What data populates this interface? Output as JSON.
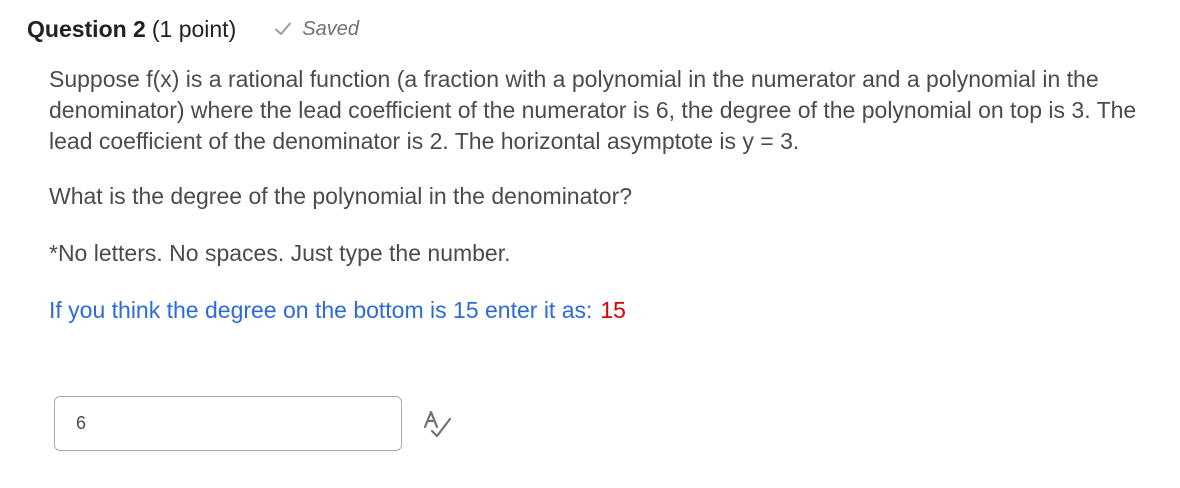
{
  "question": {
    "name": "Question 2",
    "points": "(1 point)",
    "status": "Saved",
    "status_icon": "check-icon"
  },
  "body": {
    "paragraph1": "Suppose f(x) is a rational function (a fraction with a polynomial in the numerator and a polynomial in the denominator) where the lead coefficient of the numerator is 6, the degree of the polynomial on top is 3.  The lead coefficient of the denominator is 2.  The horizontal asymptote is y = 3.",
    "paragraph2": "What is the degree of the polynomial in the denominator?",
    "paragraph3": "*No letters.  No spaces.  Just type the number.",
    "paragraph4": "If you think the degree on the bottom is 15 enter it as:",
    "example_value": "15"
  },
  "answer": {
    "value": "6"
  },
  "toolbar": {
    "spell_check_icon": "spell-check-icon"
  },
  "colors": {
    "text": "#494c4e",
    "title": "#202122",
    "blue_note": "#2d6bd8",
    "red_value": "#e00000",
    "input_border": "#a9aaab"
  }
}
